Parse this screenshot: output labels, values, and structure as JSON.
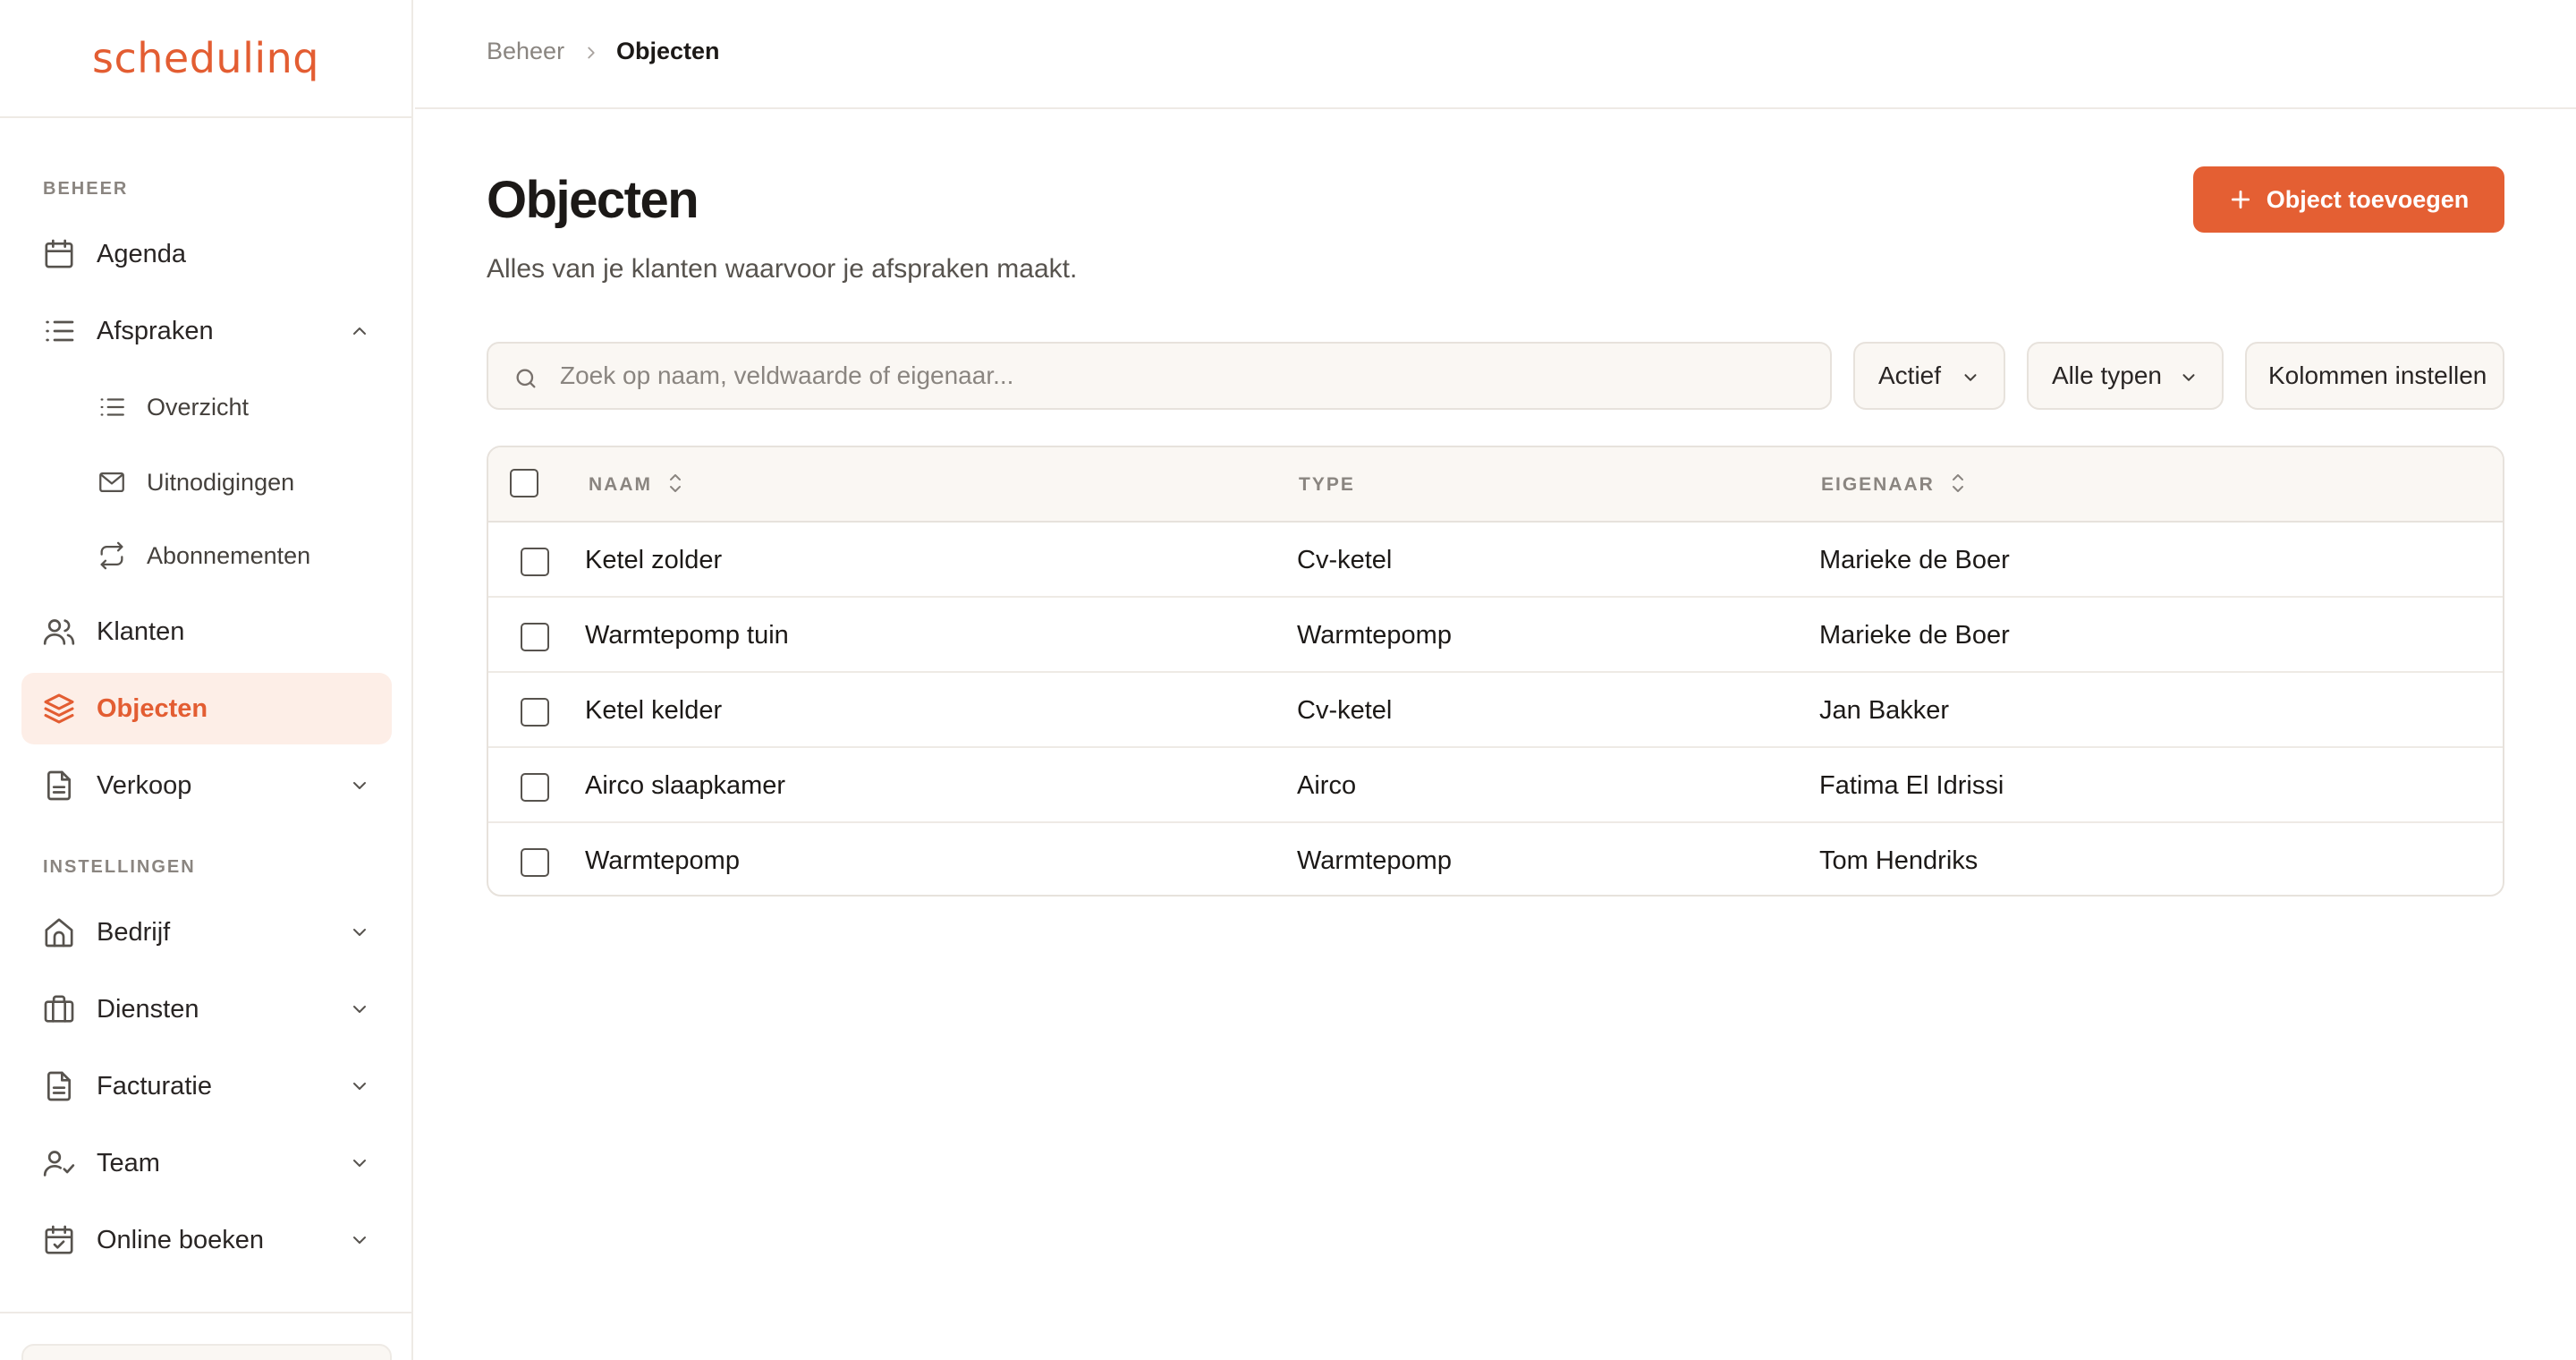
{
  "brand": {
    "logo_text": "schedulinq",
    "accent": "#e35d32"
  },
  "sidebar": {
    "section_manage": "BEHEER",
    "section_settings": "INSTELLINGEN",
    "items": [
      {
        "label": "Agenda",
        "icon": "calendar-icon"
      },
      {
        "label": "Afspraken",
        "icon": "list-icon",
        "expanded": true
      },
      {
        "label": "Klanten",
        "icon": "users-icon"
      },
      {
        "label": "Objecten",
        "icon": "layers-icon",
        "active": true
      },
      {
        "label": "Verkoop",
        "icon": "document-icon"
      }
    ],
    "sub_items": [
      {
        "label": "Overzicht",
        "icon": "list-icon"
      },
      {
        "label": "Uitnodigingen",
        "icon": "mail-icon"
      },
      {
        "label": "Abonnementen",
        "icon": "repeat-icon"
      }
    ],
    "settings_items": [
      {
        "label": "Bedrijf",
        "icon": "home-icon"
      },
      {
        "label": "Diensten",
        "icon": "briefcase-icon"
      },
      {
        "label": "Facturatie",
        "icon": "document-icon"
      },
      {
        "label": "Team",
        "icon": "user-check-icon"
      },
      {
        "label": "Online boeken",
        "icon": "calendar-check-icon"
      }
    ]
  },
  "breadcrumb": {
    "parent": "Beheer",
    "current": "Objecten"
  },
  "page": {
    "title": "Objecten",
    "subtitle": "Alles van je klanten waarvoor je afspraken maakt.",
    "add_button": "Object toevoegen"
  },
  "filters": {
    "search_placeholder": "Zoek op naam, veldwaarde of eigenaar...",
    "status": "Actief",
    "type": "Alle typen",
    "columns_button": "Kolommen instellen"
  },
  "table": {
    "headers": {
      "name": "NAAM",
      "type": "TYPE",
      "owner": "EIGENAAR"
    },
    "rows": [
      {
        "name": "Ketel zolder",
        "type": "Cv-ketel",
        "owner": "Marieke de Boer"
      },
      {
        "name": "Warmtepomp tuin",
        "type": "Warmtepomp",
        "owner": "Marieke de Boer"
      },
      {
        "name": "Ketel kelder",
        "type": "Cv-ketel",
        "owner": "Jan Bakker"
      },
      {
        "name": "Airco slaapkamer",
        "type": "Airco",
        "owner": "Fatima El Idrissi"
      },
      {
        "name": "Warmtepomp",
        "type": "Warmtepomp",
        "owner": "Tom Hendriks"
      }
    ]
  }
}
